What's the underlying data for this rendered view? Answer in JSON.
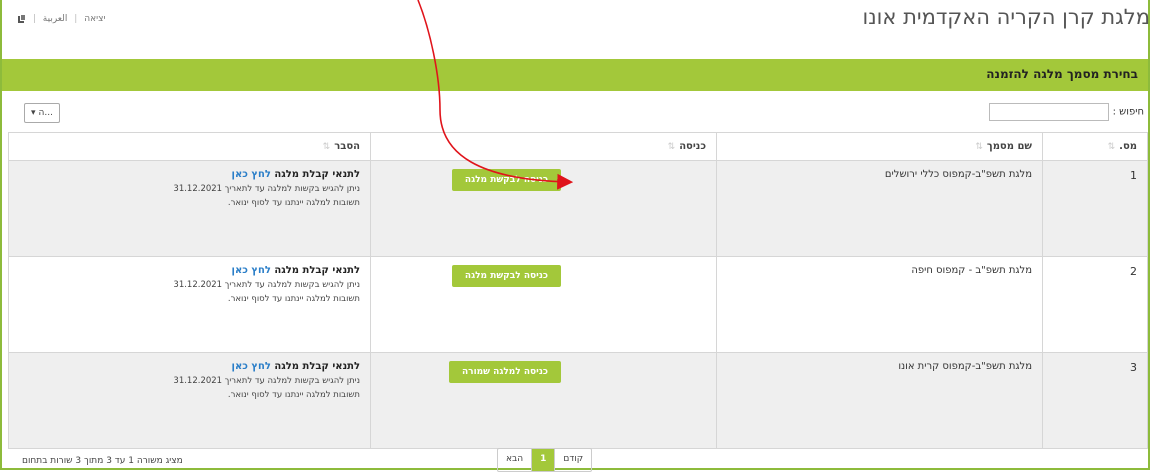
{
  "site_title": "מלגת קרן הקריה האקדמית אונו",
  "toplinks": {
    "exit": "יציאה",
    "arabic": "العربية"
  },
  "section_title": "בחירת מסמך מלגה להזמנה",
  "search": {
    "label": "חיפוש :",
    "value": ""
  },
  "length_button": "ה...",
  "table": {
    "headers": {
      "no": "מס.",
      "doc_name": "שם מסמך",
      "entry": "כניסה",
      "explanation": "הסבר"
    },
    "rows": [
      {
        "no": "1",
        "doc_name": "מלגת תשפ\"ב-קמפוס כללי ירושלים",
        "entry_button": "כניסה לבקשת מלגה",
        "expl_title": "לתנאי קבלת מלגה",
        "expl_link": "לחץ כאן",
        "expl_line1": "ניתן להגיש בקשות למלגה עד לתאריך 31.12.2021",
        "expl_line2": "תשובות למלגה יינתנו עד לסוף ינואר."
      },
      {
        "no": "2",
        "doc_name": "מלגת תשפ\"ב - קמפוס חיפה",
        "entry_button": "כניסה לבקשת מלגה",
        "expl_title": "לתנאי קבלת מלגה",
        "expl_link": "לחץ כאן",
        "expl_line1": "ניתן להגיש בקשות למלגה עד לתאריך 31.12.2021",
        "expl_line2": "תשובות למלגה יינתנו עד לסוף ינואר."
      },
      {
        "no": "3",
        "doc_name": "מלגת תשפ\"ב-קמפוס קרית אונו",
        "entry_button": "כניסה למלגה שמורה",
        "expl_title": "לתנאי קבלת מלגה",
        "expl_link": "לחץ כאן",
        "expl_line1": "ניתן להגיש בקשות למלגה עד לתאריך 31.12.2021",
        "expl_line2": "תשובות למלגה יינתנו עד לסוף ינואר."
      }
    ]
  },
  "footer": {
    "info": "מציג משורה 1 עד 3 מתוך 3 שורות בתחום",
    "pager": {
      "prev": "קודם",
      "page": "1",
      "next": "הבא"
    }
  },
  "colors": {
    "brand_green": "#a3c83a",
    "annotation_arrow": "#e0141b",
    "link_blue": "#2a7ec8"
  },
  "annotation": "red-arrow-pointing-to-entry-button"
}
